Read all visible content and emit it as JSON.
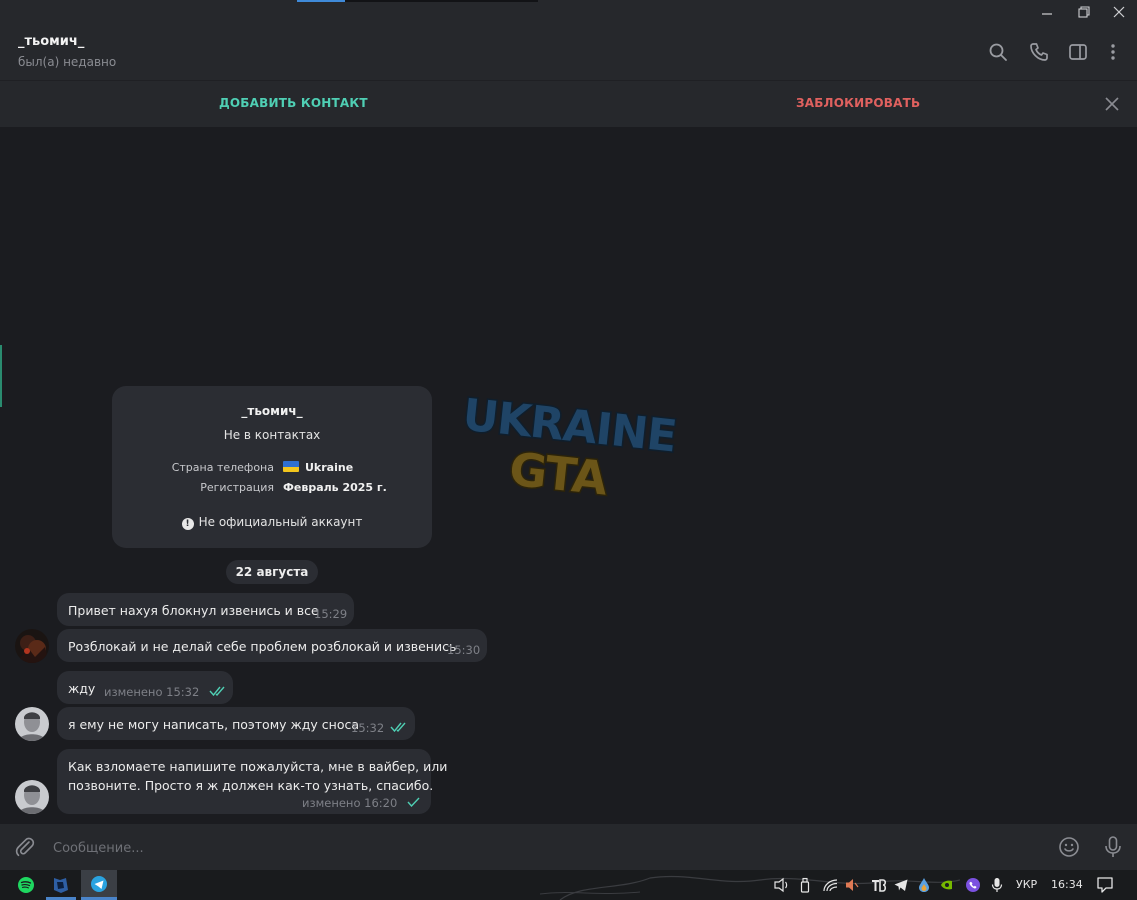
{
  "header": {
    "chat_name": "_тьомич_",
    "status": "был(а) недавно",
    "icons": [
      "search-icon",
      "phone-icon",
      "sidebar-toggle-icon",
      "more-vertical-icon"
    ]
  },
  "actionbar": {
    "add_contact": "ДОБАВИТЬ КОНТАКТ",
    "block": "ЗАБЛОКИРОВАТЬ"
  },
  "info_card": {
    "name": "_тьомич_",
    "subtitle": "Не в контактах",
    "country_label": "Страна телефона",
    "country_value": "Ukraine",
    "registration_label": "Регистрация",
    "registration_value": "Февраль 2025 г.",
    "warning": "Не официальный аккаунт"
  },
  "watermark": {
    "line1": "UKRAINE",
    "line2": "GTA"
  },
  "date_separator": "22 августа",
  "messages": [
    {
      "text": "Привет нахуя блокнул извенись и все",
      "time": "15:29",
      "direction": "in"
    },
    {
      "text": "Розблокай и не делай себе проблем розблокай и извенись",
      "time": "15:30",
      "direction": "in"
    },
    {
      "text": "жду",
      "time": "изменено 15:32",
      "direction": "out",
      "status": "read"
    },
    {
      "text": "я ему не могу написать, поэтому жду сноса",
      "time": "15:32",
      "direction": "out",
      "status": "read"
    },
    {
      "text_line1": "Как взломаете напишите пожалуйста, мне в вайбер, или",
      "text_line2": "позвоните. Просто я ж должен как-то узнать, спасибо.",
      "time": "изменено 16:20",
      "direction": "out",
      "status": "sent"
    }
  ],
  "composer": {
    "placeholder": "Сообщение..."
  },
  "taskbar": {
    "language": "УКР",
    "time": "16:34"
  },
  "colors": {
    "accent_green": "#4fcfb4",
    "danger_red": "#e0615f",
    "bubble": "#2b2d33",
    "background": "#1b1c20",
    "panel": "#26282c"
  }
}
